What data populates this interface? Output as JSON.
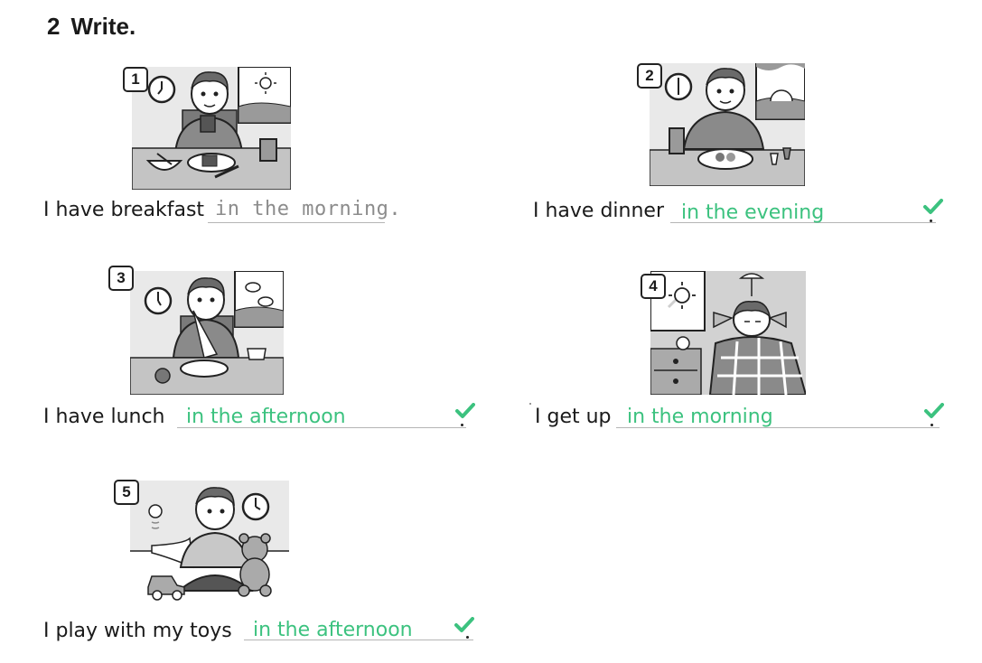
{
  "header": {
    "number": "2",
    "title": "Write."
  },
  "items": [
    {
      "number": "1",
      "prompt": "I have breakfast",
      "answer": "in the morning."
    },
    {
      "number": "2",
      "prompt": "I have dinner",
      "answer": "in the evening"
    },
    {
      "number": "3",
      "prompt": "I have lunch",
      "answer": "in the afternoon"
    },
    {
      "number": "4",
      "prompt": "I get up",
      "answer": "in the morning"
    },
    {
      "number": "5",
      "prompt": "I play with my toys",
      "answer": "in the afternoon"
    }
  ],
  "colors": {
    "answer_green": "#3cc27f",
    "tick_green": "#3cc27f",
    "example_grey": "#8c8c8c",
    "illustration_bg": "#e9e9e9"
  },
  "icons": [
    "clock-icon",
    "sun-icon",
    "cloud-icon",
    "tick-icon",
    "lamp-icon",
    "alarm-clock-icon",
    "teddy-bear-icon",
    "toy-car-icon",
    "ball-icon",
    "apple-icon",
    "bowl-icon",
    "glass-icon"
  ]
}
